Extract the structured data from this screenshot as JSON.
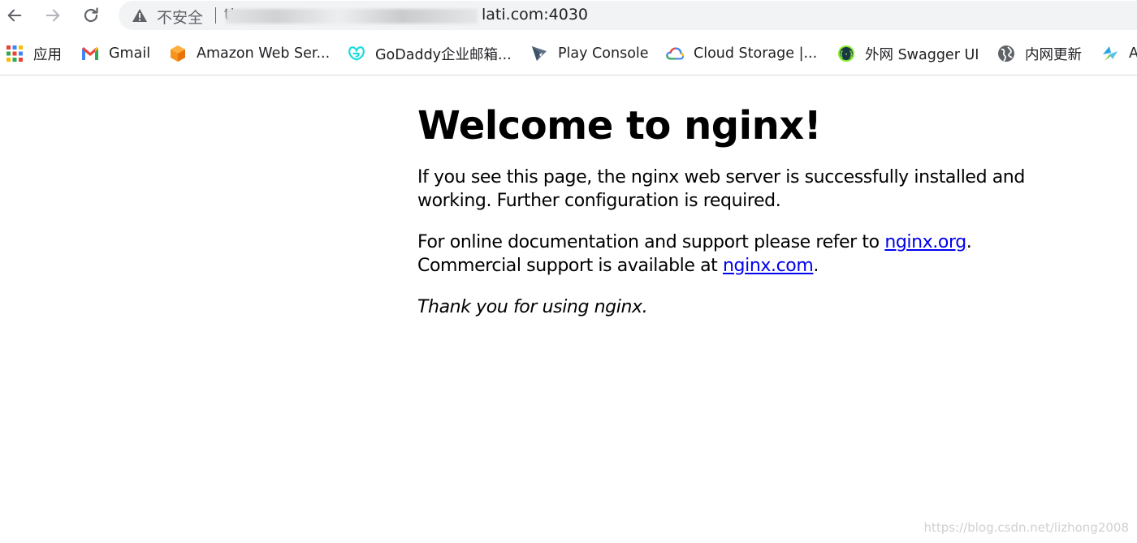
{
  "browser": {
    "security_label": "不安全",
    "url_visible_prefix": "ti",
    "url_visible_suffix": "lati.com:4030"
  },
  "bookmarks": [
    {
      "label": "应用",
      "icon": "apps-grid-icon"
    },
    {
      "label": "Gmail",
      "icon": "gmail-icon"
    },
    {
      "label": "Amazon Web Ser...",
      "icon": "aws-cube-icon"
    },
    {
      "label": "GoDaddy企业邮箱...",
      "icon": "godaddy-icon"
    },
    {
      "label": "Play Console",
      "icon": "play-console-icon"
    },
    {
      "label": "Cloud Storage |...",
      "icon": "google-cloud-icon"
    },
    {
      "label": "外网 Swagger UI",
      "icon": "swagger-icon"
    },
    {
      "label": "内网更新",
      "icon": "globe-icon"
    },
    {
      "label": "A",
      "icon": "feather-icon"
    }
  ],
  "page": {
    "heading": "Welcome to nginx!",
    "para1": "If you see this page, the nginx web server is successfully installed and working. Further configuration is required.",
    "para2_prefix": "For online documentation and support please refer to ",
    "link_org": "nginx.org",
    "para2_mid": ".",
    "para2_line2": "Commercial support is available at ",
    "link_com": "nginx.com",
    "para2_end": ".",
    "thanks": "Thank you for using nginx."
  },
  "watermark": "https://blog.csdn.net/lizhong2008",
  "colors": {
    "link": "#0000ee",
    "omnibox_bg": "#f1f3f4"
  }
}
